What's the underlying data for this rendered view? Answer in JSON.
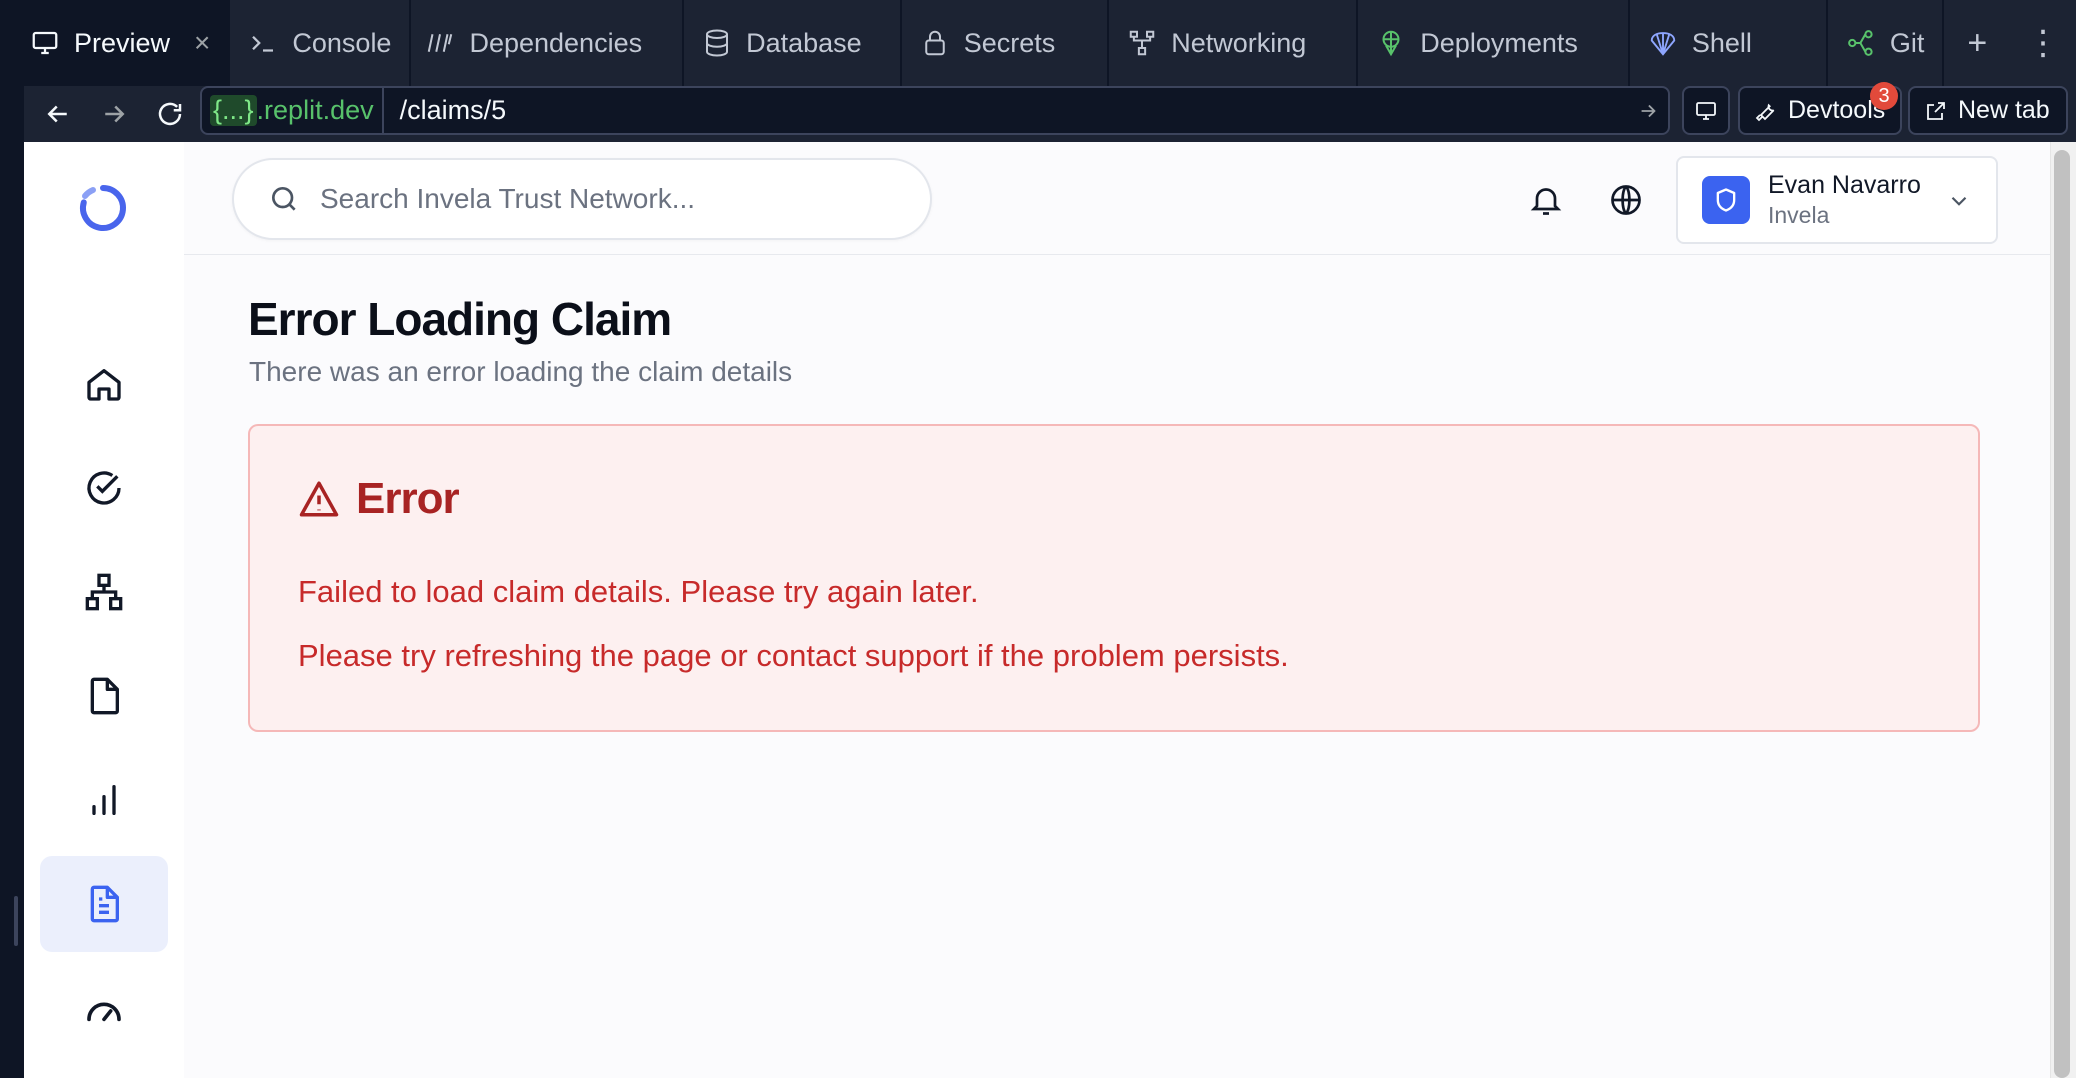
{
  "browser": {
    "tabs": [
      {
        "label": "Preview",
        "icon": "monitor-icon",
        "active": true
      },
      {
        "label": "Console",
        "icon": "terminal-icon"
      },
      {
        "label": "Dependencies",
        "icon": "dependencies-icon"
      },
      {
        "label": "Database",
        "icon": "database-icon"
      },
      {
        "label": "Secrets",
        "icon": "lock-icon"
      },
      {
        "label": "Networking",
        "icon": "networking-icon"
      },
      {
        "label": "Deployments",
        "icon": "deployments-icon"
      },
      {
        "label": "Shell",
        "icon": "shell-icon"
      },
      {
        "label": "Git",
        "icon": "git-icon"
      }
    ],
    "close_glyph": "×",
    "add_glyph": "+",
    "more_glyph": "⋮",
    "url_host_braces": "{...}",
    "url_host_domain": ".replit.dev",
    "url_path": "/claims/5",
    "devtools_label": "Devtools",
    "devtools_badge": "3",
    "new_tab_label": "New tab"
  },
  "header": {
    "search_placeholder": "Search Invela Trust Network...",
    "user_name": "Evan Navarro",
    "user_org": "Invela"
  },
  "sidebar": {
    "items": [
      {
        "name": "home-icon"
      },
      {
        "name": "tasks-icon"
      },
      {
        "name": "network-icon"
      },
      {
        "name": "file-icon"
      },
      {
        "name": "insights-icon"
      },
      {
        "name": "claims-icon",
        "active": true
      },
      {
        "name": "risk-score-icon"
      }
    ]
  },
  "main": {
    "title": "Error Loading Claim",
    "subtitle": "There was an error loading the claim details",
    "error": {
      "title": "Error",
      "message": "Failed to load claim details. Please try again later.",
      "hint": "Please try refreshing the page or contact support if the problem persists."
    }
  },
  "colors": {
    "accent": "#3b63f0",
    "error_text": "#c72a2a",
    "error_bg": "#fdf0f0",
    "error_border": "#f5b8b8",
    "ide_bg": "#1c2333"
  }
}
